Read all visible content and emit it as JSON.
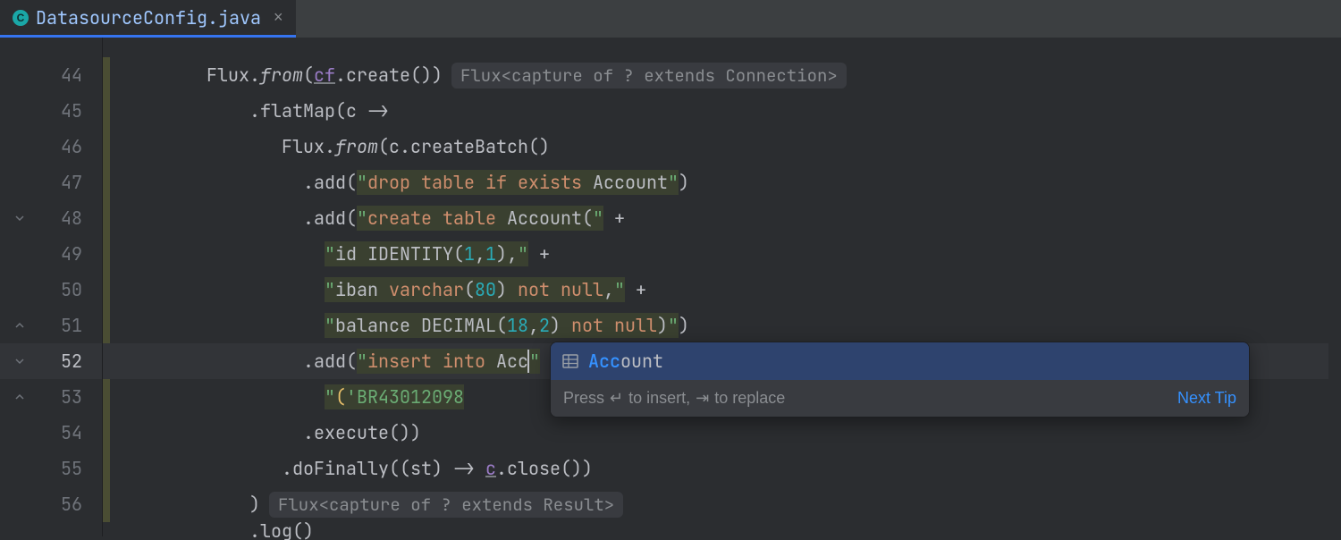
{
  "tab": {
    "filename": "DatasourceConfig.java",
    "icon_letter": "C"
  },
  "gutter": {
    "start": 44,
    "count": 13,
    "current": 52
  },
  "code": {
    "l44": {
      "obj": "Flux",
      "dot": ".",
      "from": "from",
      "lp": "(",
      "cf": "cf",
      "dot2": ".",
      "create": "create",
      "rp": "()",
      "rp2": ")"
    },
    "hint44": "Flux<capture of ? extends Connection>",
    "l45": {
      "dot": ".",
      "m": "flatMap",
      "arg": "(c ->"
    },
    "l46": {
      "obj": "Flux",
      "dot": ".",
      "from": "from",
      "lp": "(",
      "c": "c",
      "dot2": ".",
      "cb": "createBatch",
      "rp": "()"
    },
    "l47": {
      "dot": ".",
      "m": "add",
      "lp": "(",
      "q1": "\"",
      "drop": "drop",
      "sp1": " ",
      "table": "table",
      "sp2": " ",
      "if": "if",
      "sp3": " ",
      "exists": "exists",
      "sp4": " Account",
      "q2": "\"",
      "rp": ")"
    },
    "l48": {
      "dot": ".",
      "m": "add",
      "lp": "(",
      "q1": "\"",
      "create": "create",
      "sp1": " ",
      "table": "table",
      "sp2": " Account(",
      "q2": "\"",
      "plus": " +"
    },
    "l49": {
      "q1": "\"",
      "id": "id",
      "sp1": " IDENTITY(",
      "n1": "1",
      "c": ",",
      "n2": "1",
      "rp": "),",
      "q2": "\"",
      "plus": " +"
    },
    "l50": {
      "q1": "\"",
      "iban": "iban",
      "sp1": " ",
      "varchar": "varchar",
      "lp": "(",
      "n": "80",
      "rp2": ") ",
      "not": "not",
      "sp2": " ",
      "null": "null",
      "c": ",",
      "q2": "\"",
      "plus": " +"
    },
    "l51": {
      "q1": "\"",
      "bal": "balance",
      "sp1": " DECIMAL(",
      "n1": "18",
      "c": ",",
      "n2": "2",
      "rp": ") ",
      "not": "not",
      "sp2": " ",
      "null": "null",
      "rp2": ")",
      "q2": "\"",
      "rp3": ")"
    },
    "l52": {
      "dot": ".",
      "m": "add",
      "lp": "(",
      "q1": "\"",
      "insert": "insert",
      "sp1": " ",
      "into": "into",
      "sp2": " ",
      "acc": "Acc",
      "q2": "\"",
      "plus": " +"
    },
    "l53": {
      "q1": "\"",
      "lp": "(",
      "br": "'BR43012098"
    },
    "l54": {
      "dot": ".",
      "m": "execute",
      "p": "())"
    },
    "l55": {
      "dot": ".",
      "m": "doFinally",
      "lp": "((st) -> ",
      "c": "c",
      "dot2": ".",
      "close": "close",
      "rp": "())"
    },
    "l56": {
      "rp": ")"
    },
    "hint56": "Flux<capture of ? extends Result>"
  },
  "popup": {
    "matched": "Acc",
    "rest": "ount",
    "footer_press": "Press ",
    "footer_insert": " to insert, ",
    "footer_replace": " to replace",
    "next_tip": "Next Tip"
  }
}
